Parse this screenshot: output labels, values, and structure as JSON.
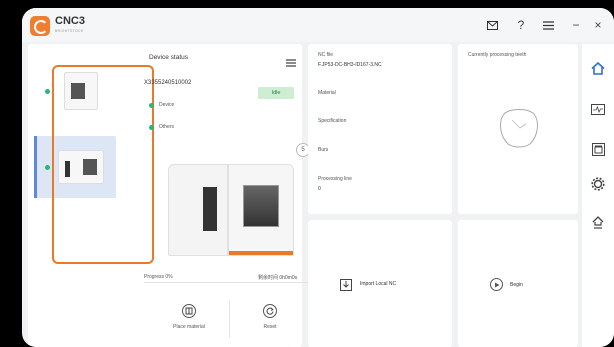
{
  "app": {
    "title": "CNC3",
    "subtitle": "BRIGHTSTOCK"
  },
  "titlebar": {
    "icons": [
      "mail-icon",
      "help-icon",
      "menu-icon",
      "minimize-icon",
      "close-icon"
    ],
    "help": "?",
    "minimize": "−",
    "close": "×"
  },
  "device_status": {
    "title": "Device status",
    "serial": "X3355240510002",
    "status": "Idle",
    "device_label": "Device",
    "others_label": "Others",
    "count": "5",
    "progress": "Progress 0%",
    "time": "剩余时间 0h0m0s",
    "place_material": "Place material",
    "reset": "Reset"
  },
  "nc": {
    "file_label": "NC file",
    "file_value": "F.JP53-DC-BH3-ID167-3.NC",
    "material_label": "Material",
    "spec_label": "Specification",
    "burs_label": "Burs",
    "line_label": "Processing line",
    "line_value": "0",
    "import": "Import Local NC"
  },
  "teeth": {
    "label": "Currently processing teeth",
    "begin": "Begin"
  },
  "colors": {
    "accent": "#e87a2c",
    "idle_bg": "#cdeed3",
    "online": "#2bb673",
    "selected": "#dde6f4"
  },
  "sidebar_icons": [
    "home-icon",
    "monitor-icon",
    "gallery-icon",
    "settings-icon",
    "upload-icon"
  ]
}
